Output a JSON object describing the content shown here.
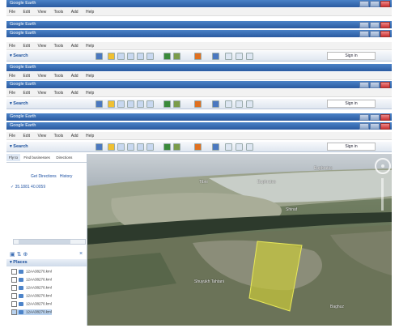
{
  "app": {
    "title": "Google Earth",
    "menu": [
      "File",
      "Edit",
      "View",
      "Tools",
      "Add",
      "Help"
    ],
    "search_label": "▾ Search",
    "sign_in_label": "Sign in"
  },
  "sidebar": {
    "tabs": [
      "Fly to",
      "Find businesses",
      "Directions"
    ],
    "links": [
      "Get Directions",
      "History"
    ],
    "result": "✓ 35.1881 40.0059",
    "places_label": "▾ Places",
    "places": [
      "12AA38270.kml",
      "12AA38270.kml",
      "12AA38270.kml",
      "12AA38270.kml",
      "12AA38270.kml",
      "12AA38270.kml"
    ]
  },
  "map": {
    "labels": [
      "Tibni",
      "Euphrates",
      "Euphrates",
      "Shinaf",
      "Shuyukh Tahtani",
      "Baghuz"
    ]
  }
}
